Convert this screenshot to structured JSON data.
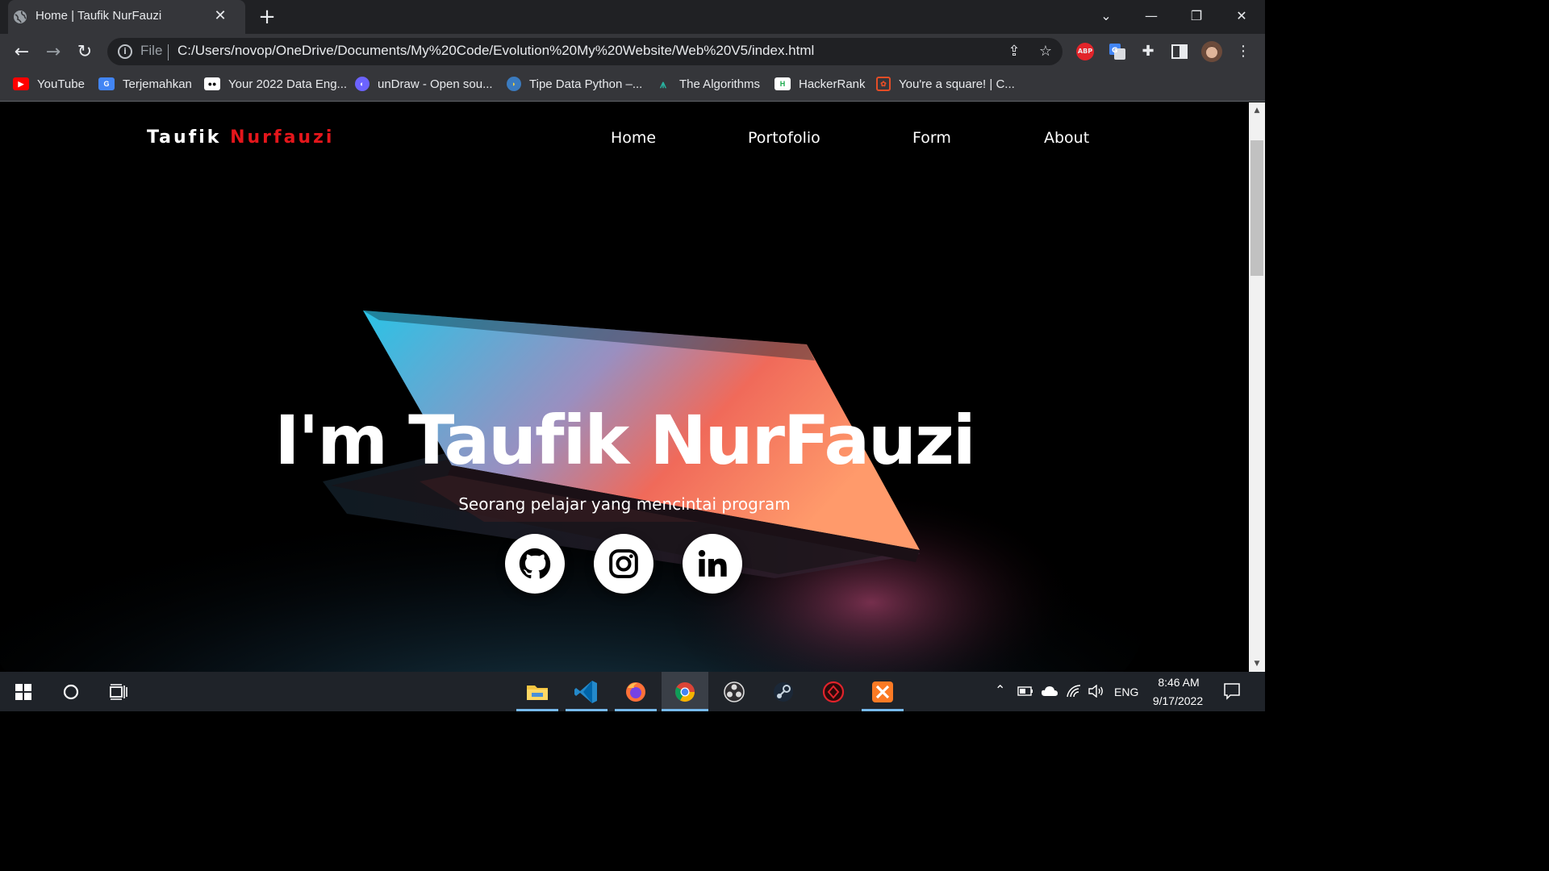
{
  "browser": {
    "tab_title": "Home | Taufik NurFauzi",
    "tab_close": "✕",
    "new_tab": "+",
    "scheme_label": "File",
    "url": "C:/Users/novop/OneDrive/Documents/My%20Code/Evolution%20My%20Website/Web%20V5/index.html",
    "extension_abp": "ABP"
  },
  "bookmarks": [
    {
      "label": "YouTube",
      "icon": "youtube-icon"
    },
    {
      "label": "Terjemahkan",
      "icon": "google-translate-icon"
    },
    {
      "label": "Your 2022 Data Eng...",
      "icon": "medium-icon"
    },
    {
      "label": "unDraw - Open sou...",
      "icon": "undraw-icon"
    },
    {
      "label": "Tipe Data Python –...",
      "icon": "python-icon"
    },
    {
      "label": "The Algorithms",
      "icon": "algorithms-icon"
    },
    {
      "label": "HackerRank",
      "icon": "hackerrank-icon"
    },
    {
      "label": "You're a square! | C...",
      "icon": "square-icon"
    }
  ],
  "site": {
    "brand_first": "Taufik",
    "brand_second": "Nurfauzi",
    "brand_accent": "#e4161b",
    "nav": [
      "Home",
      "Portofolio",
      "Form",
      "About"
    ],
    "hero_title": "I'm Taufik NurFauzi",
    "hero_subtitle": "Seorang pelajar yang mencintai program",
    "social": [
      "github-icon",
      "instagram-icon",
      "linkedin-icon"
    ]
  },
  "taskbar": {
    "language": "ENG",
    "time": "8:46 AM",
    "date": "9/17/2022"
  }
}
